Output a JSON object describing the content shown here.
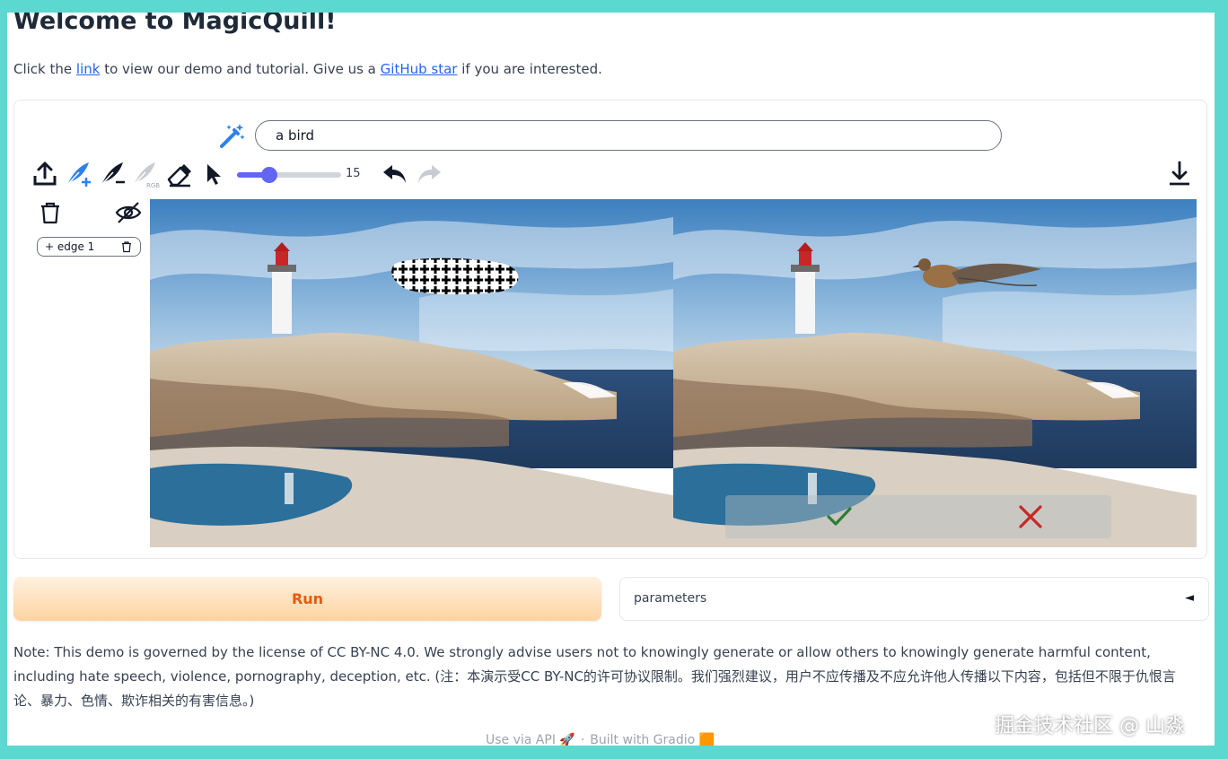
{
  "header": {
    "title": "Welcome to MagicQuill!",
    "intro_before_link": "Click the ",
    "intro_link": "link",
    "intro_middle": " to view our demo and tutorial. Give us a ",
    "intro_github": "GitHub star",
    "intro_after": " if you are interested."
  },
  "editor": {
    "prompt_value": "a bird",
    "brush_size": "15",
    "brush_level": 0.31,
    "layers": [
      {
        "label": "+ edge 1"
      }
    ],
    "icons": {
      "wand": "magic-wand-icon",
      "upload": "upload-icon",
      "add_brush": "add-brush-icon",
      "subtract_brush": "subtract-brush-icon",
      "color_brush": "color-brush-icon",
      "eraser": "eraser-icon",
      "cursor": "cursor-icon",
      "undo": "undo-icon",
      "redo": "redo-icon",
      "download": "download-icon",
      "trash": "trash-icon",
      "hide": "eye-off-icon",
      "accept": "check-icon",
      "reject": "close-icon"
    },
    "colors": {
      "accent": "#6366f1",
      "add_brush": "#2f80ed",
      "accept": "#2e7d32",
      "reject": "#c62828"
    }
  },
  "actions": {
    "run_label": "Run",
    "parameters_label": "parameters",
    "parameters_arrow": "◄"
  },
  "note": "Note: This demo is governed by the license of CC BY-NC 4.0. We strongly advise users not to knowingly generate or allow others to knowingly generate harmful content, including hate speech, violence, pornography, deception, etc. (注：本演示受CC BY-NC的许可协议限制。我们强烈建议，用户不应传播及不应允许他人传播以下内容，包括但不限于仇恨言论、暴力、色情、欺诈相关的有害信息。)",
  "footer": {
    "api": "Use via API 🚀",
    "sep": "·",
    "built": "Built with Gradio 🟧"
  },
  "watermark": "掘金技术社区 @ 山淼"
}
